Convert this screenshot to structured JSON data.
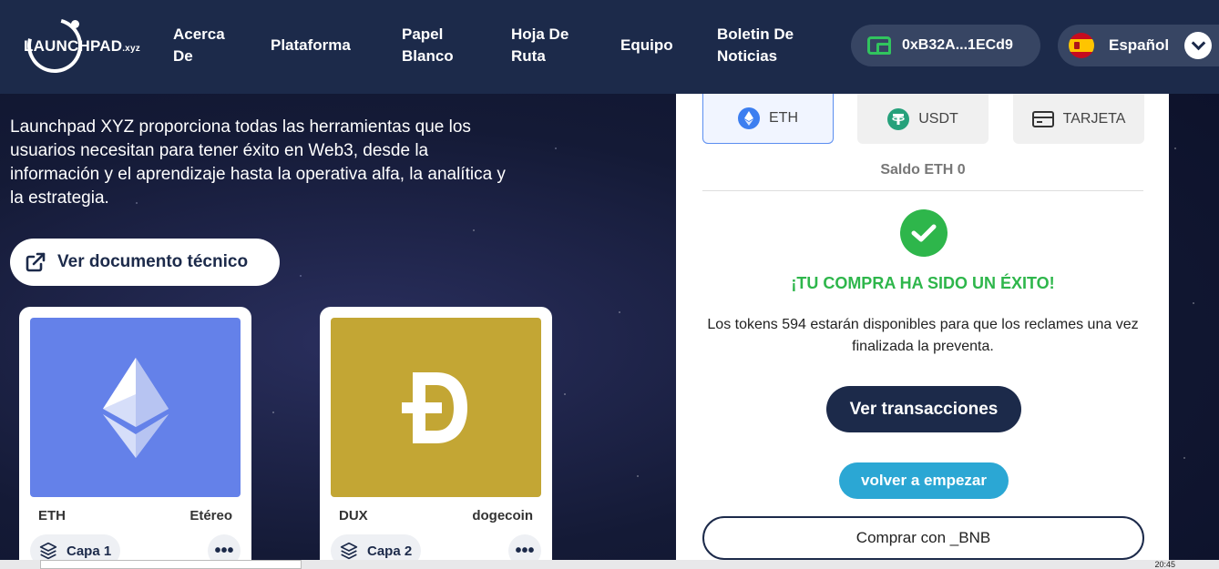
{
  "header": {
    "logo": {
      "main": "LAUNCHPAD",
      "suffix": ".xyz"
    },
    "nav": [
      {
        "label1": "Acerca",
        "label2": "De"
      },
      {
        "label1": "Plataforma",
        "label2": ""
      },
      {
        "label1": "Papel",
        "label2": "Blanco"
      },
      {
        "label1": "Hoja De",
        "label2": "Ruta"
      },
      {
        "label1": "Equipo",
        "label2": ""
      },
      {
        "label1": "Boletin De",
        "label2": "Noticias"
      }
    ],
    "wallet_address": "0xB32A...1ECd9",
    "language": "Español"
  },
  "hero": {
    "intro": "Launchpad XYZ proporciona todas las herramientas que los usuarios necesitan para tener éxito en Web3, desde la información y el aprendizaje hasta la operativa alfa, la analítica y la estrategia.",
    "doc_button": "Ver documento técnico"
  },
  "tokens": [
    {
      "symbol": "ETH",
      "name": "Etéreo",
      "layer": "Capa 1",
      "color": "#6481e9"
    },
    {
      "symbol": "DUX",
      "name": "dogecoin",
      "layer": "Capa 2",
      "color": "#c3a634"
    }
  ],
  "panel": {
    "tabs": [
      {
        "label": "ETH",
        "icon": "eth-icon",
        "active": true
      },
      {
        "label": "USDT",
        "icon": "usdt-icon",
        "active": false
      },
      {
        "label": "TARJETA",
        "icon": "card-icon",
        "active": false
      }
    ],
    "balance": "Saldo ETH 0",
    "success": "¡TU COMPRA HA SIDO UN ÉXITO!",
    "message": "Los tokens 594 estarán disponibles para que los reclames una vez finalizada la preventa.",
    "transactions_button": "Ver transacciones",
    "restart_button": "volver a empezar",
    "bnb_button": "Comprar con _BNB"
  },
  "taskbar": {
    "time": "20:45"
  },
  "colors": {
    "navy": "#1c2a4a",
    "green": "#2eb64b",
    "cyan": "#2ba7d4"
  }
}
